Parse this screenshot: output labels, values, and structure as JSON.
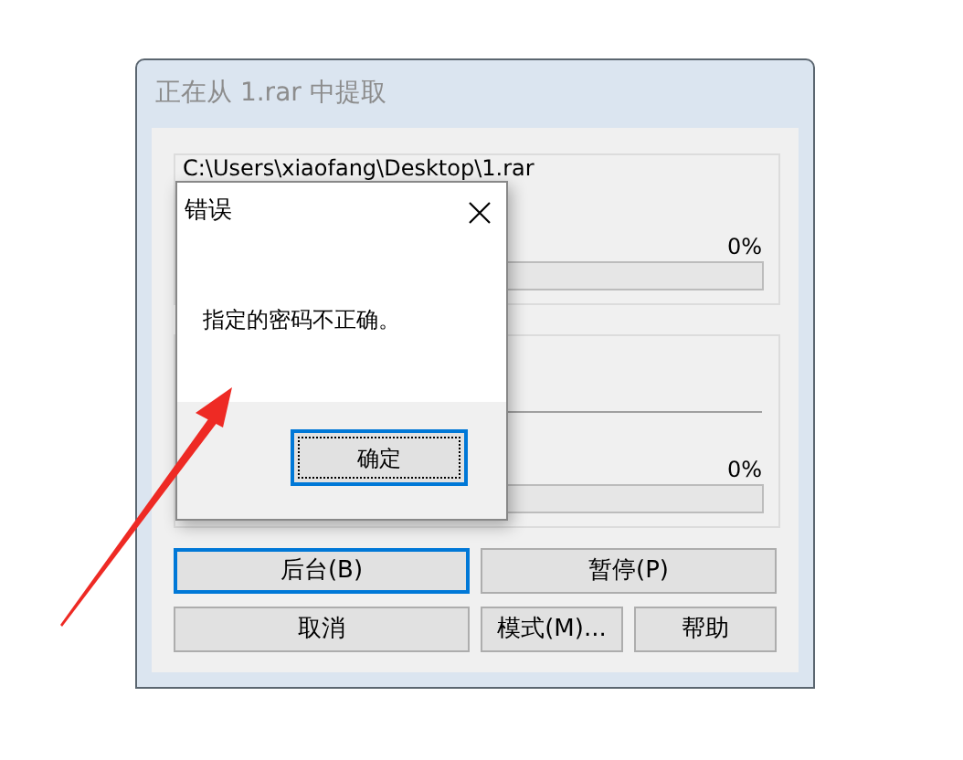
{
  "window": {
    "title": "正在从 1.rar 中提取"
  },
  "file_group": {
    "path": "C:\\Users\\xiaofang\\Desktop\\1.rar",
    "percent": "0%",
    "level": 0
  },
  "total_group": {
    "percent": "0%",
    "level": 0
  },
  "button_rows": [
    [
      {
        "label": "后台(B)",
        "focused": true
      },
      {
        "label": "暂停(P)",
        "focused": false
      }
    ],
    [
      {
        "label": "取消",
        "focused": false
      },
      {
        "label": "模式(M)...",
        "focused": false
      },
      {
        "label": "帮助",
        "focused": false
      }
    ]
  ],
  "error_dialog": {
    "title": "错误",
    "message": "指定的密码不正确。",
    "button": {
      "label": "确定",
      "focused": true
    }
  },
  "annotation": {
    "kind": "arrow"
  }
}
